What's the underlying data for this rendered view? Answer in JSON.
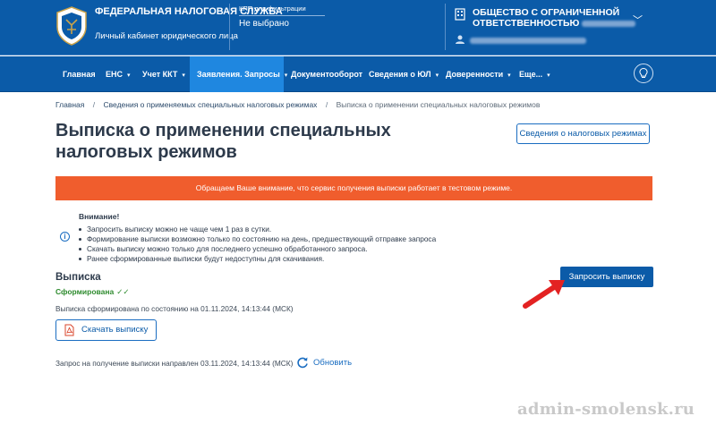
{
  "header": {
    "org_title": "ФЕДЕРАЛЬНАЯ НАЛОГОВАЯ СЛУЖБА",
    "org_subtitle": "Личный кабинет юридического лица",
    "kpp_label": "КПП для фильтрации",
    "kpp_value": "Не выбрано",
    "company_name": "ОБЩЕСТВО С ОГРАНИЧЕННОЙ ОТВЕТСТВЕННОСТЬЮ",
    "brand_color": "#0b5ba8"
  },
  "nav": {
    "items": [
      {
        "label": "Главная",
        "caret": ""
      },
      {
        "label": "ЕНС",
        "caret": "▾"
      },
      {
        "label": "Учет ККТ",
        "caret": "▾"
      },
      {
        "label": "Заявления. Запросы",
        "caret": "▾"
      },
      {
        "label": "Документооборот",
        "caret": ""
      },
      {
        "label": "Сведения о ЮЛ",
        "caret": "▾"
      },
      {
        "label": "Доверенности",
        "caret": "▾"
      },
      {
        "label": "Еще...",
        "caret": "▾"
      }
    ],
    "active_index": 3,
    "active_color": "#1f87e0"
  },
  "breadcrumbs": {
    "home": "Главная",
    "section": "Сведения о применяемых специальных налоговых режимах",
    "current": "Выписка о применении специальных налоговых режимов",
    "separator": "/"
  },
  "page": {
    "title": "Выписка о применении специальных налоговых режимов",
    "info_button": "Сведения о налоговых режимах"
  },
  "notice": {
    "text": "Обращаем Ваше внимание, что сервис получения выписки работает в тестовом режиме.",
    "color": "#f05d2d"
  },
  "warning": {
    "icon": "i",
    "title": "Внимание!",
    "items": [
      "Запросить выписку можно не чаще чем 1 раз в сутки.",
      "Формирование выписки возможно только по состоянию на день, предшествующий отправке запроса",
      "Скачать выписку можно только для последнего успешно обработанного запроса.",
      "Ранее сформированные выписки будут недоступны для скачивания."
    ]
  },
  "extract": {
    "section_title": "Выписка",
    "status": "Сформирована",
    "status_mark": "✓✓",
    "status_color": "#2e8b2e",
    "formed_text": "Выписка сформирована по состоянию на 01.11.2024, 14:13:44 (МСК)",
    "download_button": "Скачать выписку",
    "request_button": "Запросить выписку",
    "sent_text": "Запрос на получение выписки направлен 03.11.2024, 14:13:44 (МСК)",
    "refresh_label": "Обновить"
  },
  "watermark": "admin-smolensk.ru"
}
